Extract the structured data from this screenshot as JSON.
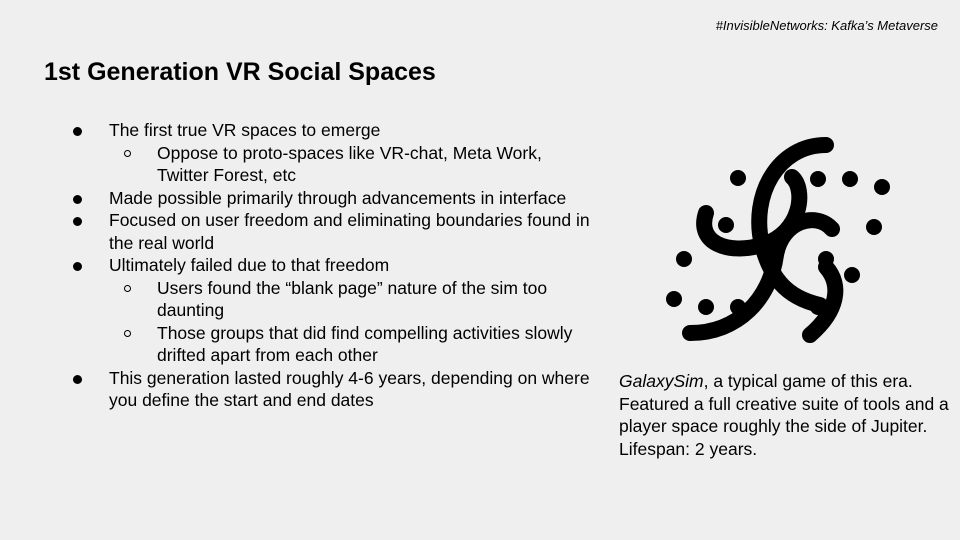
{
  "header": {
    "tag": "#InvisibleNetworks: Kafka’s Metaverse"
  },
  "slide": {
    "title": "1st Generation VR Social Spaces"
  },
  "bullets": [
    {
      "level": 1,
      "text": "The first true VR spaces to emerge"
    },
    {
      "level": 2,
      "text": "Oppose to proto-spaces like VR-chat, Meta Work, Twitter Forest, etc"
    },
    {
      "level": 1,
      "text": "Made possible primarily through advancements in interface"
    },
    {
      "level": 1,
      "text": "Focused on user freedom and eliminating boundaries found in the real world"
    },
    {
      "level": 1,
      "text": "Ultimately failed due to that freedom"
    },
    {
      "level": 2,
      "text": "Users found the “blank page” nature of the sim too daunting"
    },
    {
      "level": 2,
      "text": "Those groups that did find compelling activities slowly drifted apart from each other"
    },
    {
      "level": 1,
      "text": "This generation lasted roughly 4-6 years, depending on where you define the start and end dates"
    }
  ],
  "image": {
    "icon": "galaxy-swirl-icon"
  },
  "caption": {
    "title": "GalaxySim",
    "text": ", a typical game of this era. Featured a full creative suite of tools and a player space roughly the side of Jupiter. Lifespan: 2 years."
  }
}
